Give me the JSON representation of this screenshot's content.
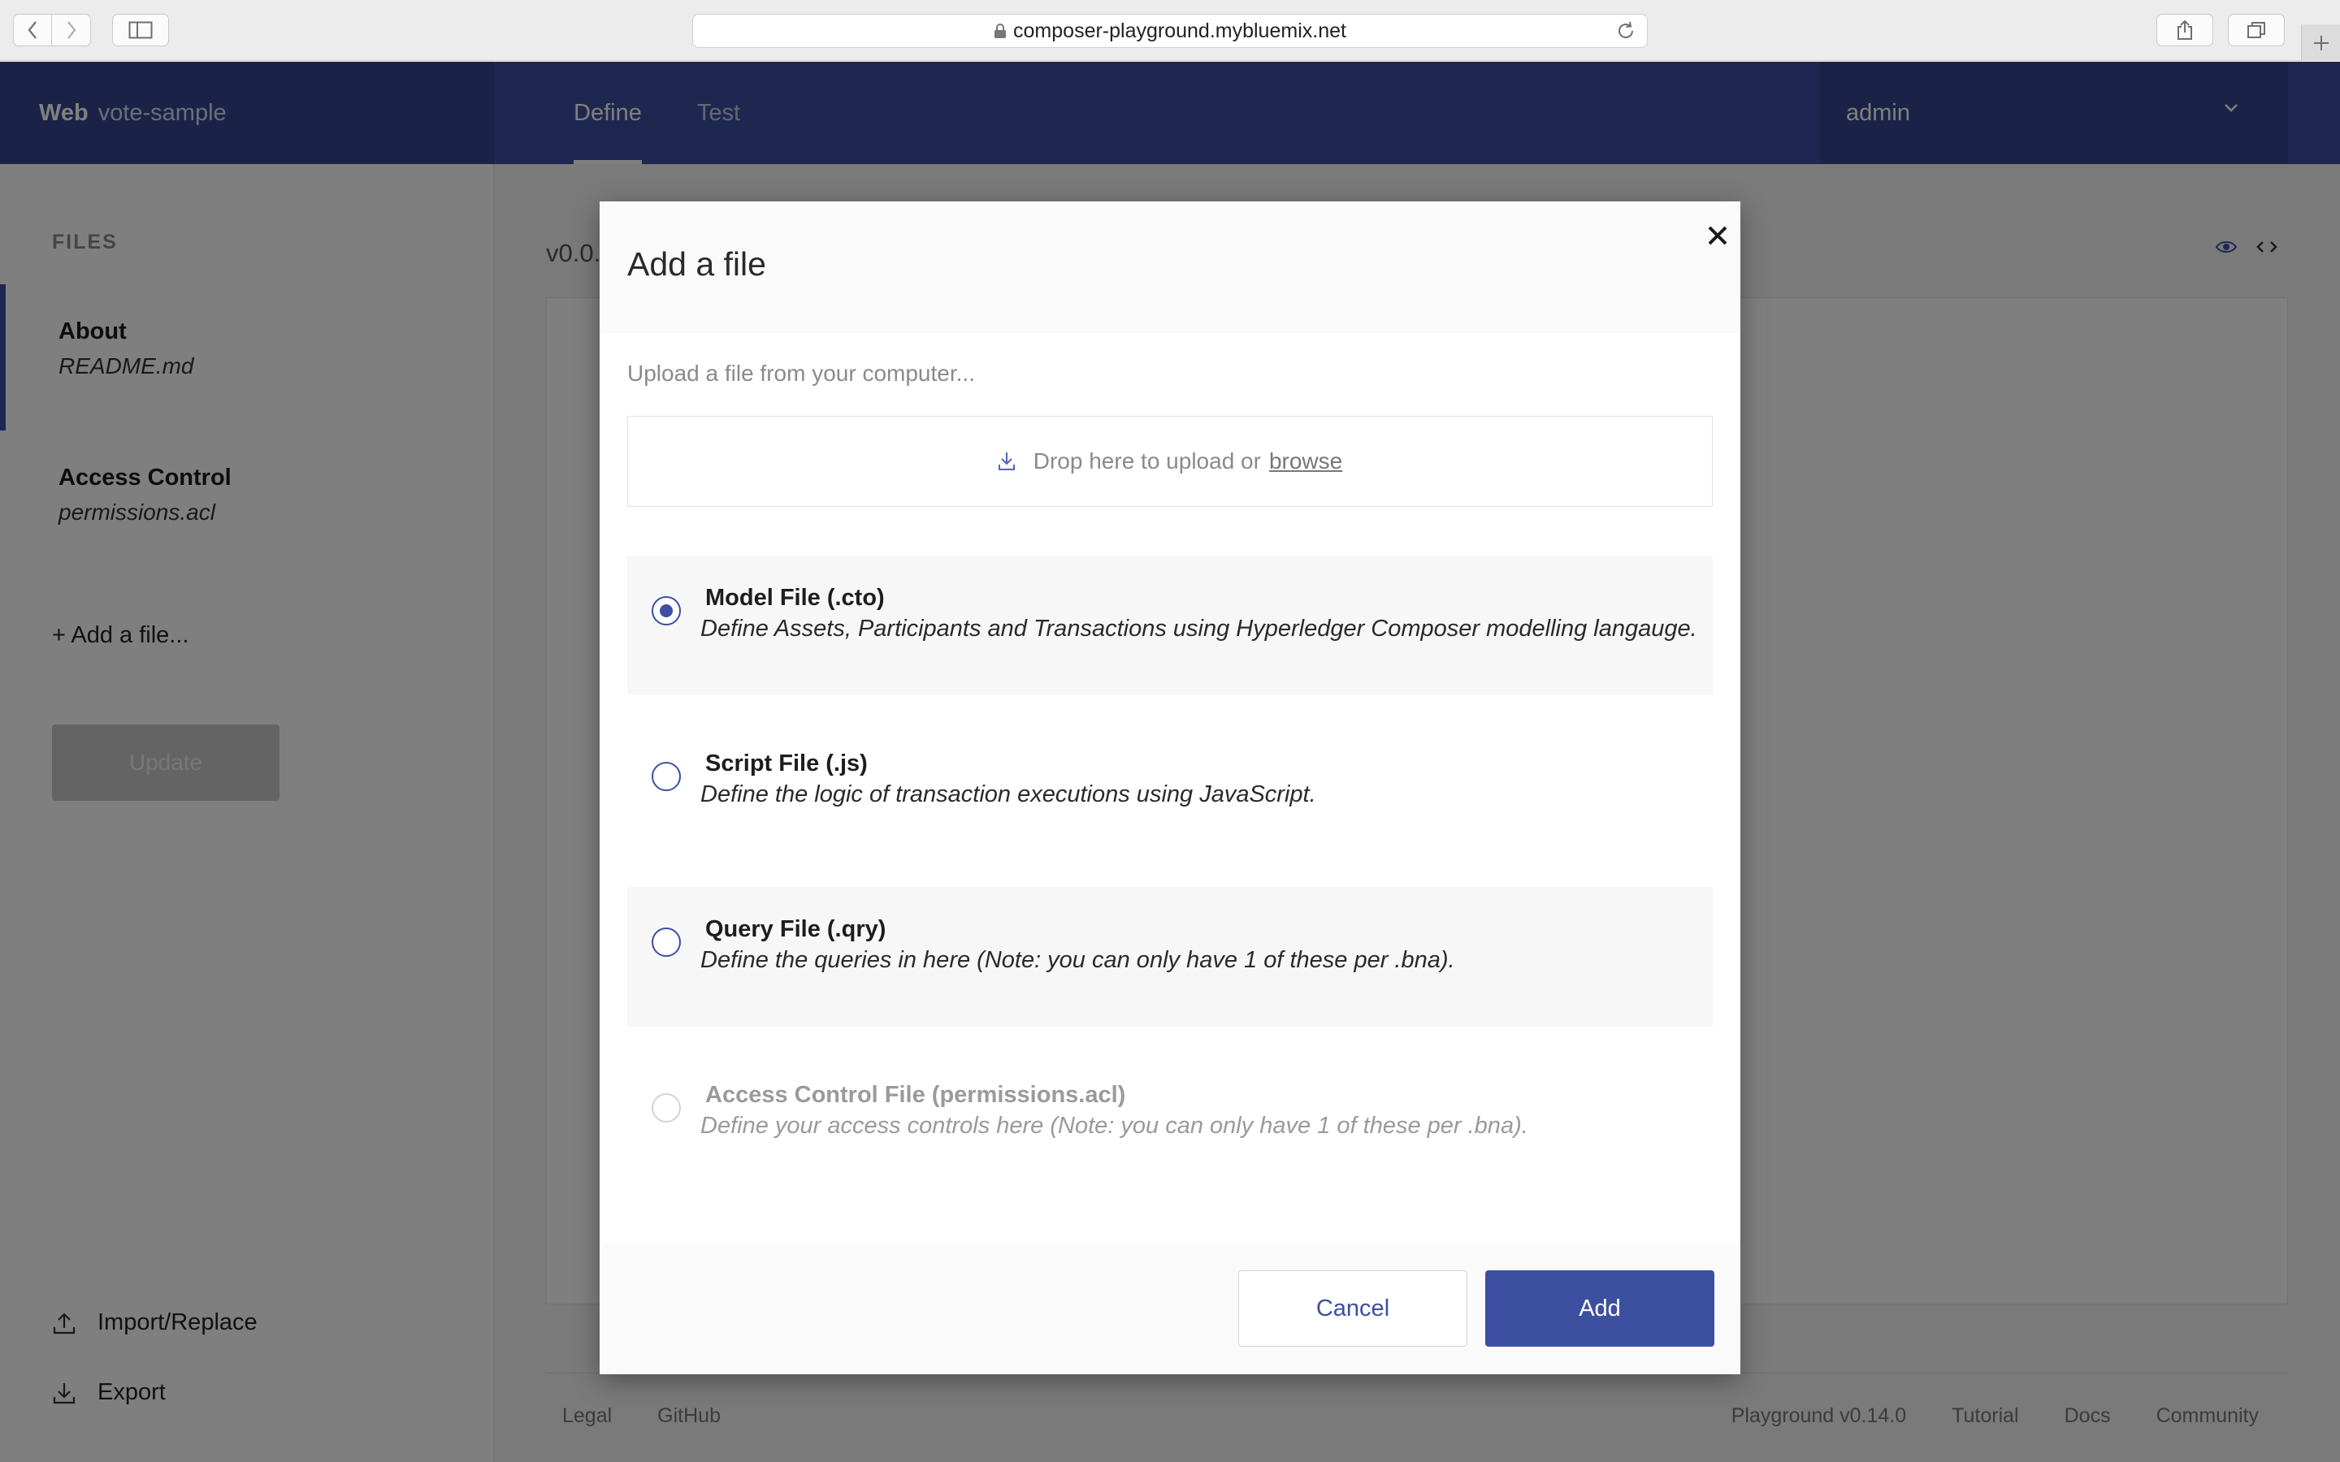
{
  "browser": {
    "url": "composer-playground.mybluemix.net"
  },
  "header": {
    "brand_bold": "Web",
    "brand_sub": "vote-sample",
    "tabs": [
      {
        "label": "Define",
        "active": true
      },
      {
        "label": "Test",
        "active": false
      }
    ],
    "user": "admin"
  },
  "sidebar": {
    "files_title": "FILES",
    "files": [
      {
        "name": "About",
        "file": "README.md",
        "selected": true
      },
      {
        "name": "Access Control",
        "file": "permissions.acl",
        "selected": false
      }
    ],
    "add_file": "+ Add a file...",
    "update_button": "Update",
    "import_label": "Import/Replace",
    "export_label": "Export"
  },
  "main": {
    "version": "v0.0.",
    "footer_left": [
      "Legal",
      "GitHub"
    ],
    "footer_right": [
      "Playground v0.14.0",
      "Tutorial",
      "Docs",
      "Community"
    ]
  },
  "modal": {
    "title": "Add a file",
    "upload_label": "Upload a file from your computer...",
    "dropzone_text": "Drop here to upload or",
    "browse_link": "browse",
    "options": [
      {
        "title": "Model File (.cto)",
        "desc": "Define Assets, Participants and Transactions using Hyperledger Composer modelling langauge.",
        "checked": true,
        "disabled": false
      },
      {
        "title": "Script File (.js)",
        "desc": "Define the logic of transaction executions using JavaScript.",
        "checked": false,
        "disabled": false
      },
      {
        "title": "Query File (.qry)",
        "desc": "Define the queries in here (Note: you can only have 1 of these per .bna).",
        "checked": false,
        "disabled": false
      },
      {
        "title": "Access Control File (permissions.acl)",
        "desc": "Define your access controls here (Note: you can only have 1 of these per .bna).",
        "checked": false,
        "disabled": true
      }
    ],
    "cancel_label": "Cancel",
    "add_label": "Add"
  },
  "colors": {
    "primary": "#3d4fa1",
    "header_dark": "#34468f",
    "overlay": "rgba(0,0,0,0.5)"
  }
}
